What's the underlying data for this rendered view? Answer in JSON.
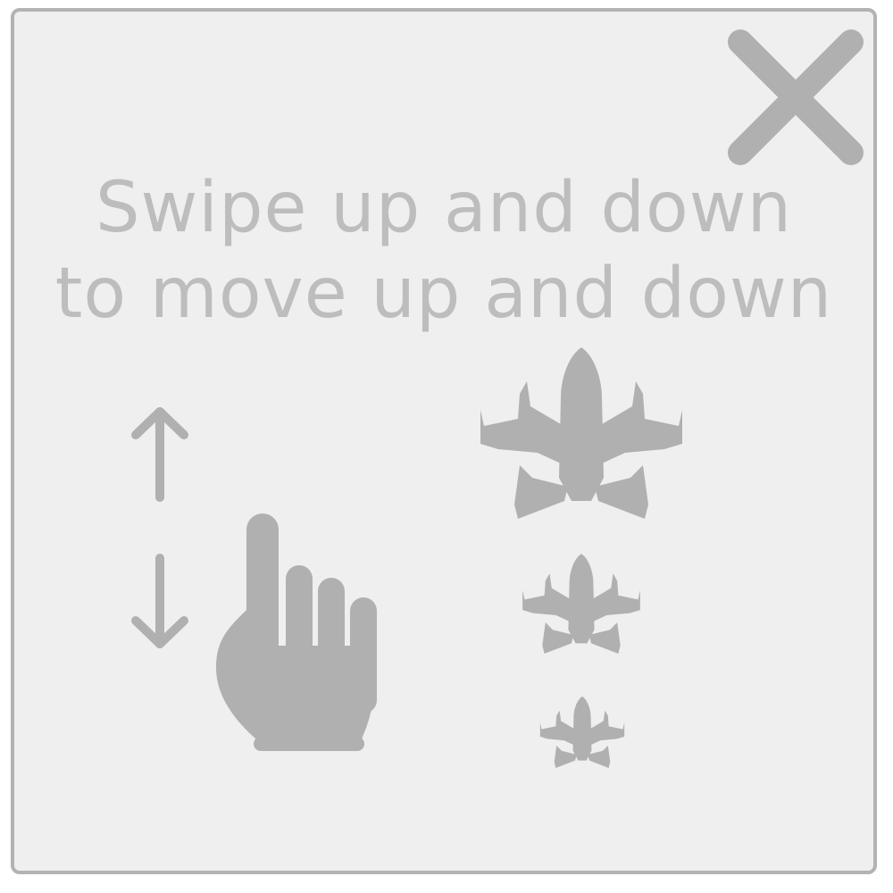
{
  "dialog": {
    "close_icon": "close-icon",
    "instruction_line1": "Swipe up and down",
    "instruction_line2": "to move up and down"
  },
  "illustration": {
    "icons": [
      "arrow-up-icon",
      "arrow-down-icon",
      "pointing-hand-icon",
      "spaceship-icon-large",
      "spaceship-icon-medium",
      "spaceship-icon-small"
    ]
  },
  "colors": {
    "panel_background": "#efefef",
    "border": "#b3b3b3",
    "icon": "#b0b0b0",
    "text": "#bdbdbd"
  }
}
